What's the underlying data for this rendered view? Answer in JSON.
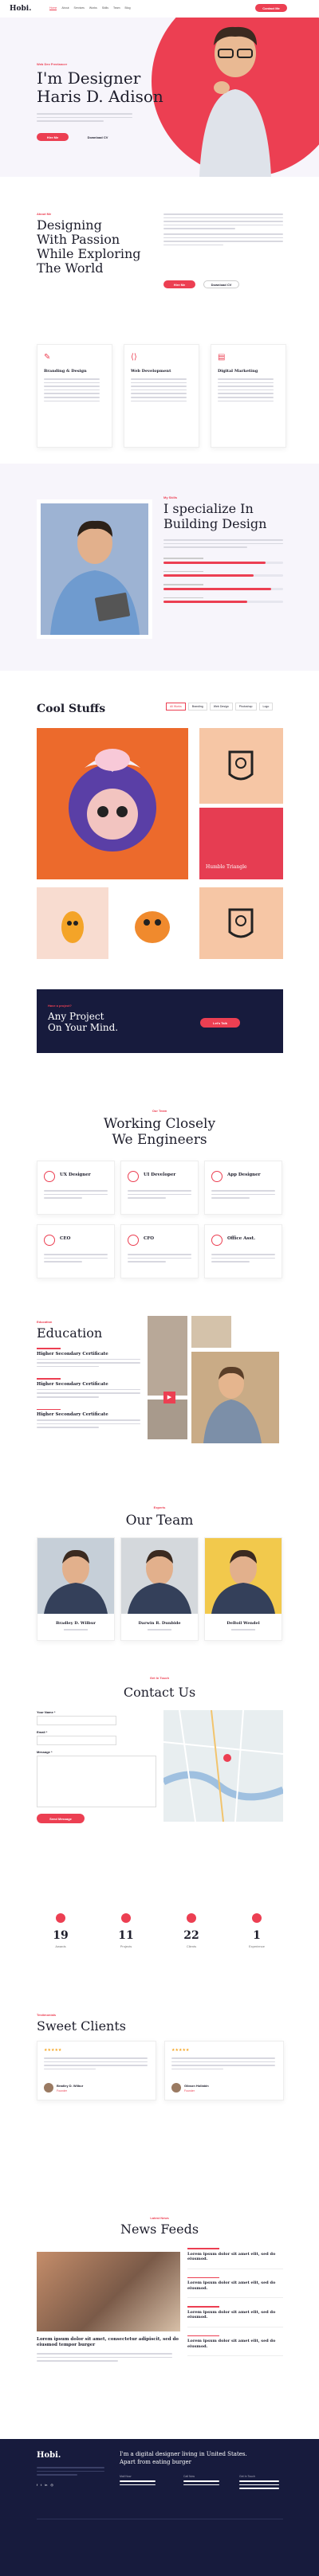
{
  "nav": {
    "logo": "Hobi.",
    "items": [
      "Home",
      "About",
      "Services",
      "Works",
      "Skills",
      "Team",
      "Blog"
    ],
    "cta": "Contact Me"
  },
  "hero": {
    "eyebrow": "Web Dev Freelancer",
    "title_line1": "I'm Designer",
    "title_line2": "Haris D. Adison",
    "btn1": "Hire Me",
    "btn2": "Download CV"
  },
  "about": {
    "tag": "About Me",
    "title_l1": "Designing",
    "title_l2": "With Passion",
    "title_l3": "While Exploring",
    "title_l4": "The World",
    "btn1": "Hire Me",
    "btn2": "Download CV"
  },
  "services": [
    {
      "title": "Branding & Design"
    },
    {
      "title": "Web Development"
    },
    {
      "title": "Digital Marketing"
    }
  ],
  "skills": {
    "tag": "My Skills",
    "title_l1": "I specialize In",
    "title_l2": "Building Design",
    "bars": [
      0.85,
      0.75,
      0.9,
      0.7
    ]
  },
  "portfolio": {
    "title": "Cool Stuffs",
    "filters": [
      "All Works",
      "Branding",
      "Web Design",
      "Photoshop",
      "Logo"
    ],
    "card_label": "Humble Triangle"
  },
  "cta": {
    "tag": "Have a project?",
    "l1": "Any Project",
    "l2": "On Your Mind.",
    "btn": "Let's Talk"
  },
  "roles": {
    "tag": "Our Team",
    "l1": "Working Closely",
    "l2": "We Engineers",
    "items": [
      "UX Designer",
      "UI Developer",
      "App Designer",
      "CEO",
      "CFO",
      "Office Asst."
    ]
  },
  "education": {
    "tag": "Education",
    "title": "Education",
    "items": [
      "Higher Secondary Certificate",
      "Higher Secondary Certificate",
      "Higher Secondary Certificate"
    ]
  },
  "team": {
    "tag": "Experts",
    "title": "Our Team",
    "members": [
      {
        "name": "Bradley D. Wilbur"
      },
      {
        "name": "Darwin R. Dunbide"
      },
      {
        "name": "DeBoil Wendel"
      }
    ]
  },
  "contact": {
    "tag": "Get In Touch",
    "title": "Contact Us",
    "name_label": "Your Name *",
    "email_label": "Email *",
    "msg_label": "Message *",
    "btn": "Send Message"
  },
  "counters": [
    {
      "value": "19",
      "label": "Awards"
    },
    {
      "value": "11",
      "label": "Projects"
    },
    {
      "value": "22",
      "label": "Clients"
    },
    {
      "value": "1",
      "label": "Experience"
    }
  ],
  "clients": {
    "tag": "Testimonials",
    "title": "Sweet Clients",
    "items": [
      {
        "name": "Bradley D. Wilbur",
        "role": "Founder"
      },
      {
        "name": "Gibson Hollabin",
        "role": "Founder"
      }
    ]
  },
  "news": {
    "tag": "Latest News",
    "title": "News Feeds",
    "main_title": "Lorem ipsum dolor sit amet, consectetur adipiscit, sed do eiusmod tempor burger",
    "items": [
      "Lorem ipsum dolor sit amet elit, sed do eiusmod.",
      "Lorem ipsum dolor sit amet elit, sed do eiusmod.",
      "Lorem ipsum dolor sit amet elit, sed do eiusmod.",
      "Lorem ipsum dolor sit amet elit, sed do eiusmod."
    ]
  },
  "footer": {
    "logo": "Hobi.",
    "headline_l1": "I'm a digital designer living in United States.",
    "headline_l2": "Apart from eating burger",
    "col1": "Mail Now",
    "col2": "Call Now",
    "col3": "Get In Touch"
  },
  "colors": {
    "accent": "#ec3f52",
    "dark": "#171b3d"
  }
}
